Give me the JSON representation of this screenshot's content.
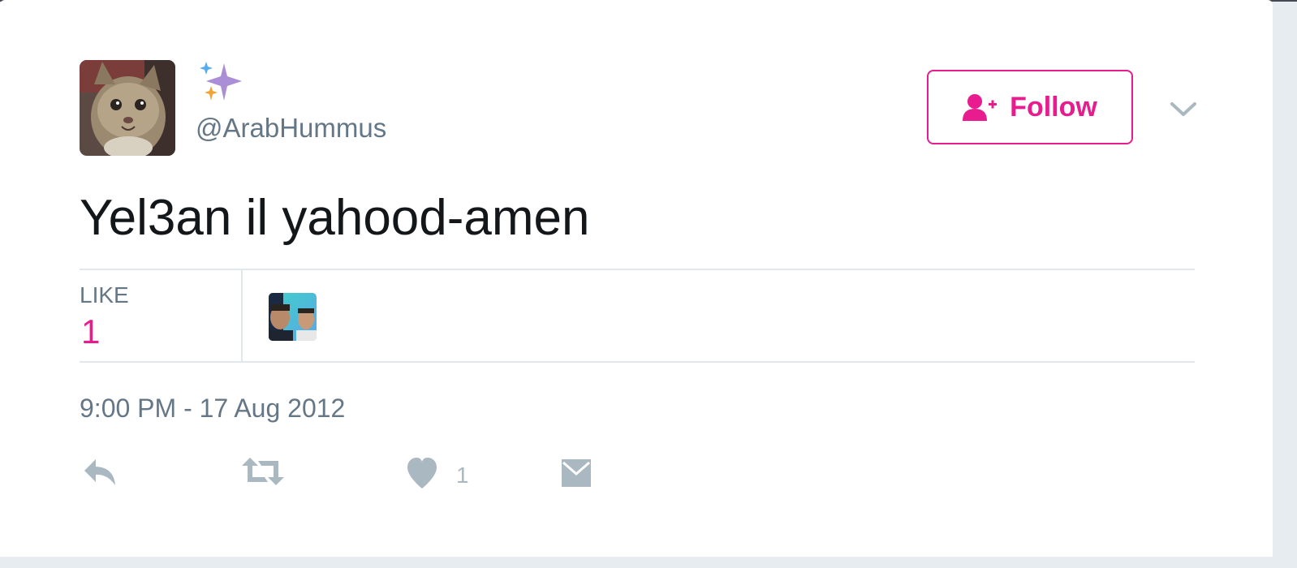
{
  "author": {
    "handle": "@ArabHummus",
    "avatar_description": "cat-photo",
    "display_name_icon": "sparkles-icon"
  },
  "follow_button": {
    "label": "Follow",
    "icon": "follow-person-plus-icon"
  },
  "menu": {
    "icon": "chevron-down-icon"
  },
  "tweet": {
    "text": "Yel3an il yahood-amen",
    "timestamp": "9:00 PM - 17 Aug 2012"
  },
  "stats": {
    "like_label": "LIKE",
    "like_count": "1"
  },
  "actions": {
    "reply_icon": "reply-icon",
    "retweet_icon": "retweet-icon",
    "like_icon": "heart-icon",
    "like_count": "1",
    "dm_icon": "envelope-icon"
  },
  "colors": {
    "accent": "#e81c8f",
    "secondary_text": "#657786",
    "action_icon": "#aab8c2",
    "divider": "#e1e8ed"
  }
}
